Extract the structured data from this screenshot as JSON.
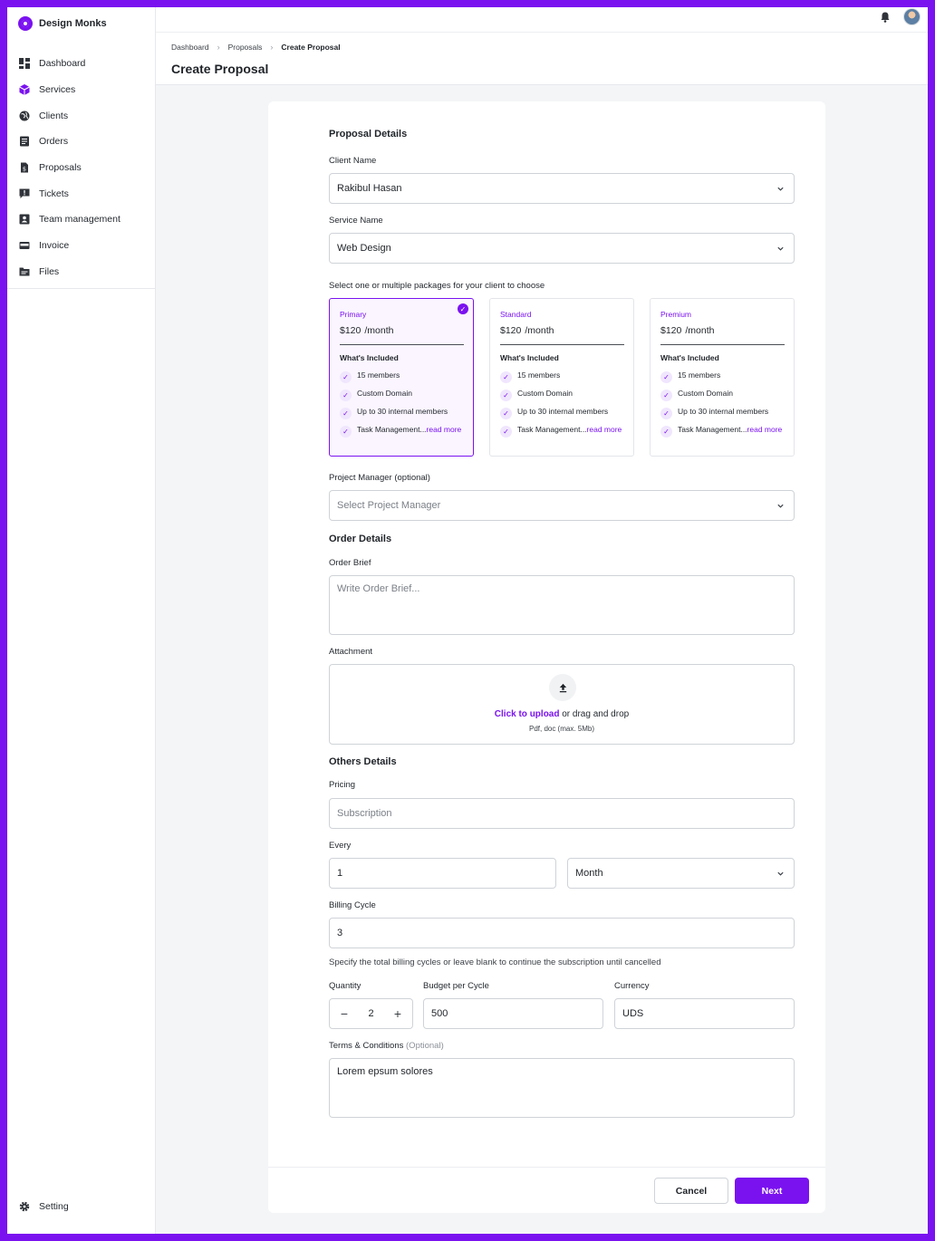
{
  "brand": {
    "name": "Design Monks"
  },
  "sidebar": {
    "items": [
      {
        "label": "Dashboard",
        "icon": "dashboard-icon"
      },
      {
        "label": "Services",
        "icon": "cube-icon"
      },
      {
        "label": "Clients",
        "icon": "globe-icon"
      },
      {
        "label": "Orders",
        "icon": "list-icon"
      },
      {
        "label": "Proposals",
        "icon": "document-icon"
      },
      {
        "label": "Tickets",
        "icon": "message-icon"
      },
      {
        "label": "Team management",
        "icon": "team-icon"
      },
      {
        "label": "Invoice",
        "icon": "card-icon"
      },
      {
        "label": "Files",
        "icon": "folder-icon"
      }
    ],
    "setting_label": "Setting"
  },
  "breadcrumb": [
    "Dashboard",
    "Proposals",
    "Create Proposal"
  ],
  "page_title": "Create Proposal",
  "form": {
    "proposal_details_title": "Proposal Details",
    "client_name_label": "Client Name",
    "client_name_value": "Rakibul Hasan",
    "service_name_label": "Service Name",
    "service_name_value": "Web Design",
    "packages_label": "Select one or multiple packages for your client to choose",
    "packages": [
      {
        "name": "Primary",
        "price": "$120",
        "per": "/month",
        "included": "What's Included",
        "features": [
          "15 members",
          "Custom Domain",
          "Up to 30 internal members",
          "Task Management..."
        ],
        "read_more": "read more",
        "selected": true
      },
      {
        "name": "Standard",
        "price": "$120",
        "per": "/month",
        "included": "What's Included",
        "features": [
          "15 members",
          "Custom Domain",
          "Up to 30 internal members",
          "Task Management..."
        ],
        "read_more": "read more",
        "selected": false
      },
      {
        "name": "Premium",
        "price": "$120",
        "per": "/month",
        "included": "What's Included",
        "features": [
          "15 members",
          "Custom Domain",
          "Up to 30 internal members",
          "Task Management..."
        ],
        "read_more": "read more",
        "selected": false
      }
    ],
    "project_manager_label": "Project Manager (optional)",
    "project_manager_placeholder": "Select Project Manager",
    "order_details_title": "Order Details",
    "order_brief_label": "Order Brief",
    "order_brief_placeholder": "Write Order Brief...",
    "attachment_label": "Attachment",
    "upload_link": "Click to upload",
    "upload_rest": " or drag and drop",
    "upload_formats": "Pdf, doc  (max. 5Mb)",
    "others_details_title": "Others Details",
    "pricing_label": "Pricing",
    "pricing_placeholder": "Subscription",
    "every_label": "Every",
    "every_value": "1",
    "every_unit": "Month",
    "billing_cycle_label": "Billing Cycle",
    "billing_cycle_value": "3",
    "billing_hint": "Specify the total billing cycles or leave blank to continue the subscription until cancelled",
    "quantity_label": "Quantity",
    "quantity_value": "2",
    "quantity_minus": "−",
    "quantity_plus": "+",
    "budget_label": "Budget per Cycle",
    "budget_value": "500",
    "currency_label": "Currency",
    "currency_value": "UDS",
    "terms_label": "Terms & Conditions",
    "terms_optional": "(Optional)",
    "terms_value": "Lorem epsum solores"
  },
  "actions": {
    "cancel": "Cancel",
    "next": "Next"
  },
  "colors": {
    "accent": "#7a12f0"
  }
}
